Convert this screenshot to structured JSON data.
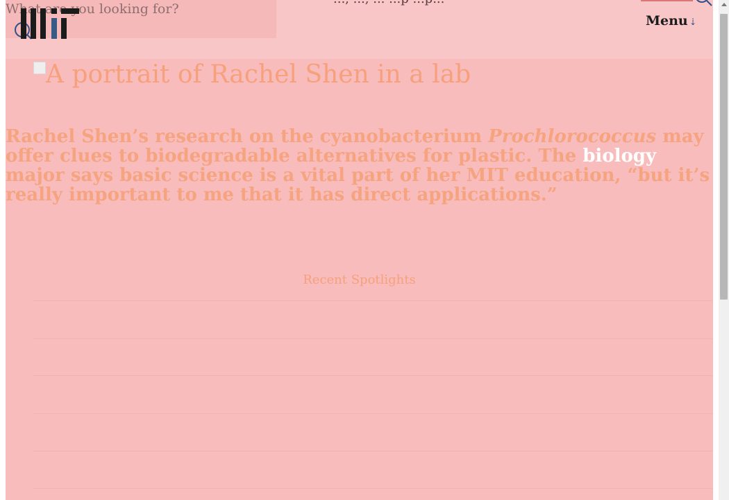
{
  "header": {
    "search_prompt": "What are you looking for?",
    "top_partial_text": "...,  ...,  ... ...p ...p...",
    "menu_label": "Menu",
    "menu_icon": "double-chevron-down-icon",
    "search_icon": "search-icon"
  },
  "main": {
    "portrait_alt": "A portrait of Rachel Shen in a lab",
    "story": {
      "part1": "Rachel Shen’s research on the cyanobacterium ",
      "italic": "Prochlorococcus",
      "part2": " may offer clues to biodegradable alternatives for plastic. The ",
      "highlight": "biology",
      "part3": " major says basic science is a vital part of her MIT education, “but it’s really important to me that it has direct applications.”"
    },
    "recent_spotlights_label": "Recent Spotlights"
  },
  "colors": {
    "page_bg": "#f8bcbc",
    "header_bg": "#f8c6c6",
    "accent_text": "#f5a47f",
    "highlight": "#ffffff"
  }
}
